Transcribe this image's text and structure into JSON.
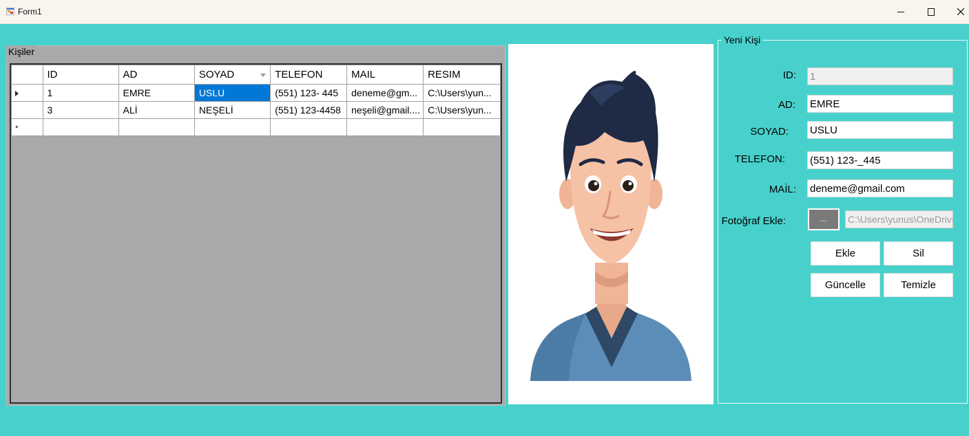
{
  "window": {
    "title": "Form1"
  },
  "kisiler": {
    "group_title": "Kişiler",
    "columns": [
      "ID",
      "AD",
      "SOYAD",
      "TELEFON",
      "MAIL",
      "RESIM"
    ],
    "rows": [
      [
        "1",
        "EMRE",
        "USLU",
        "(551) 123- 445",
        "deneme@gm...",
        "C:\\Users\\yun..."
      ],
      [
        "3",
        "ALİ",
        "NEŞELİ",
        "(551) 123-4458",
        "neşeli@gmail....",
        "C:\\Users\\yun..."
      ]
    ],
    "new_row_marker": "*"
  },
  "yeni_kisi": {
    "group_title": "Yeni Kişi",
    "id_label": "ID:",
    "id_value": "1",
    "ad_label": "AD:",
    "ad_value": "EMRE",
    "soyad_label": "SOYAD:",
    "soyad_value": "USLU",
    "telefon_label": "TELEFON:",
    "telefon_value": "(551) 123-_445",
    "mail_label": "MAİL:",
    "mail_value": "deneme@gmail.com",
    "foto_label": "Fotoğraf Ekle:",
    "browse_label": "...",
    "foto_path": "C:\\Users\\yunus\\OneDrive"
  },
  "buttons": {
    "ekle": "Ekle",
    "sil": "Sil",
    "guncelle": "Güncelle",
    "temizle": "Temizle"
  },
  "colors": {
    "form_bg": "#48D1CC",
    "grid_bg": "#A9A9A9",
    "selection": "#0078D7"
  }
}
